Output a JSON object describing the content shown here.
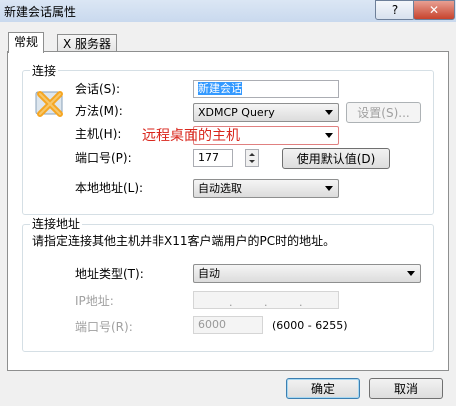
{
  "window": {
    "title": "新建会话属性",
    "help": "?",
    "close": "✕"
  },
  "tabs": [
    {
      "label": "常规"
    },
    {
      "label": "X 服务器"
    }
  ],
  "connection": {
    "group_title": "连接",
    "session_label": "会话(S):",
    "session_value": "新建会话",
    "method_label": "方法(M):",
    "method_value": "XDMCP Query",
    "settings_button": "设置(S)...",
    "host_label": "主机(H):",
    "host_value": "远程桌面的主机",
    "port_label": "端口号(P):",
    "port_value": "177",
    "default_button": "使用默认值(D)",
    "local_label": "本地地址(L):",
    "local_value": "自动选取"
  },
  "address": {
    "group_title": "连接地址",
    "description": "请指定连接其他主机并非X11客户端用户的PC时的地址。",
    "type_label": "地址类型(T):",
    "type_value": "自动",
    "ip_label": "IP地址:",
    "port_label": "端口号(R):",
    "port_value": "6000",
    "port_range": "(6000 - 6255)"
  },
  "footer": {
    "ok": "确定",
    "cancel": "取消"
  },
  "colors": {
    "host_text": "#d9261c",
    "selection": "#3399ff",
    "title_bar": "#c9d9ee"
  }
}
